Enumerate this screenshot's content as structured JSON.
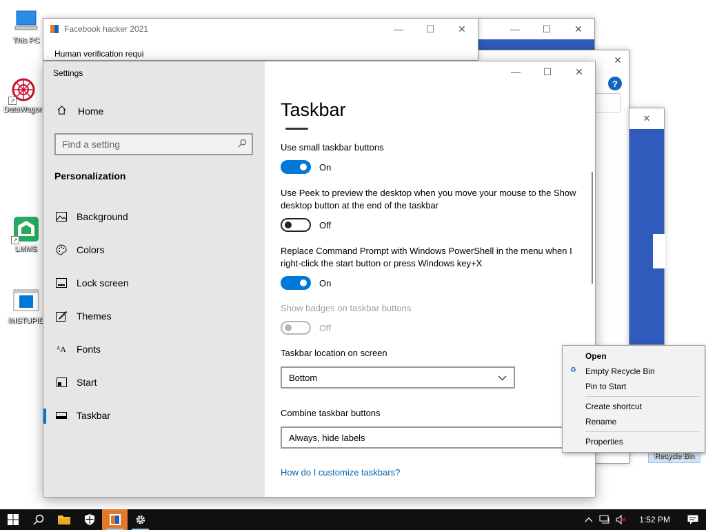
{
  "desktop": {
    "icons": [
      {
        "label": "This PC"
      },
      {
        "label": "DataWagon"
      },
      {
        "label": "LMMS"
      },
      {
        "label": "IMSTUPID"
      },
      {
        "label": "Recycle Bin"
      }
    ]
  },
  "background_windows": {
    "facebook_hacker": {
      "title": "Facebook hacker 2021",
      "body_text": "Human verification required"
    }
  },
  "settings": {
    "window_title": "Settings",
    "home_label": "Home",
    "search_placeholder": "Find a setting",
    "section_heading": "Personalization",
    "nav": [
      {
        "label": "Background",
        "icon": "image-icon"
      },
      {
        "label": "Colors",
        "icon": "palette-icon"
      },
      {
        "label": "Lock screen",
        "icon": "lock-screen-icon"
      },
      {
        "label": "Themes",
        "icon": "brush-icon"
      },
      {
        "label": "Fonts",
        "icon": "font-icon"
      },
      {
        "label": "Start",
        "icon": "start-icon"
      },
      {
        "label": "Taskbar",
        "icon": "taskbar-icon",
        "active": true
      }
    ],
    "page_title": "Taskbar",
    "options": [
      {
        "label": "Use small taskbar buttons",
        "state": "On"
      },
      {
        "label": "Use Peek to preview the desktop when you move your mouse to the Show desktop button at the end of the taskbar",
        "state": "Off"
      },
      {
        "label": "Replace Command Prompt with Windows PowerShell in the menu when I right-click the start button or press Windows key+X",
        "state": "On"
      },
      {
        "label": "Show badges on taskbar buttons",
        "state": "Off",
        "disabled": true
      }
    ],
    "location": {
      "label": "Taskbar location on screen",
      "value": "Bottom"
    },
    "combine": {
      "label": "Combine taskbar buttons",
      "value": "Always, hide labels"
    },
    "help_link": "How do I customize taskbars?",
    "accent_color": "#0078d7"
  },
  "context_menu": {
    "items": [
      "Open",
      "Empty Recycle Bin",
      "Pin to Start",
      "Create shortcut",
      "Rename",
      "Properties"
    ]
  },
  "taskbar": {
    "time": "1:52 PM"
  }
}
